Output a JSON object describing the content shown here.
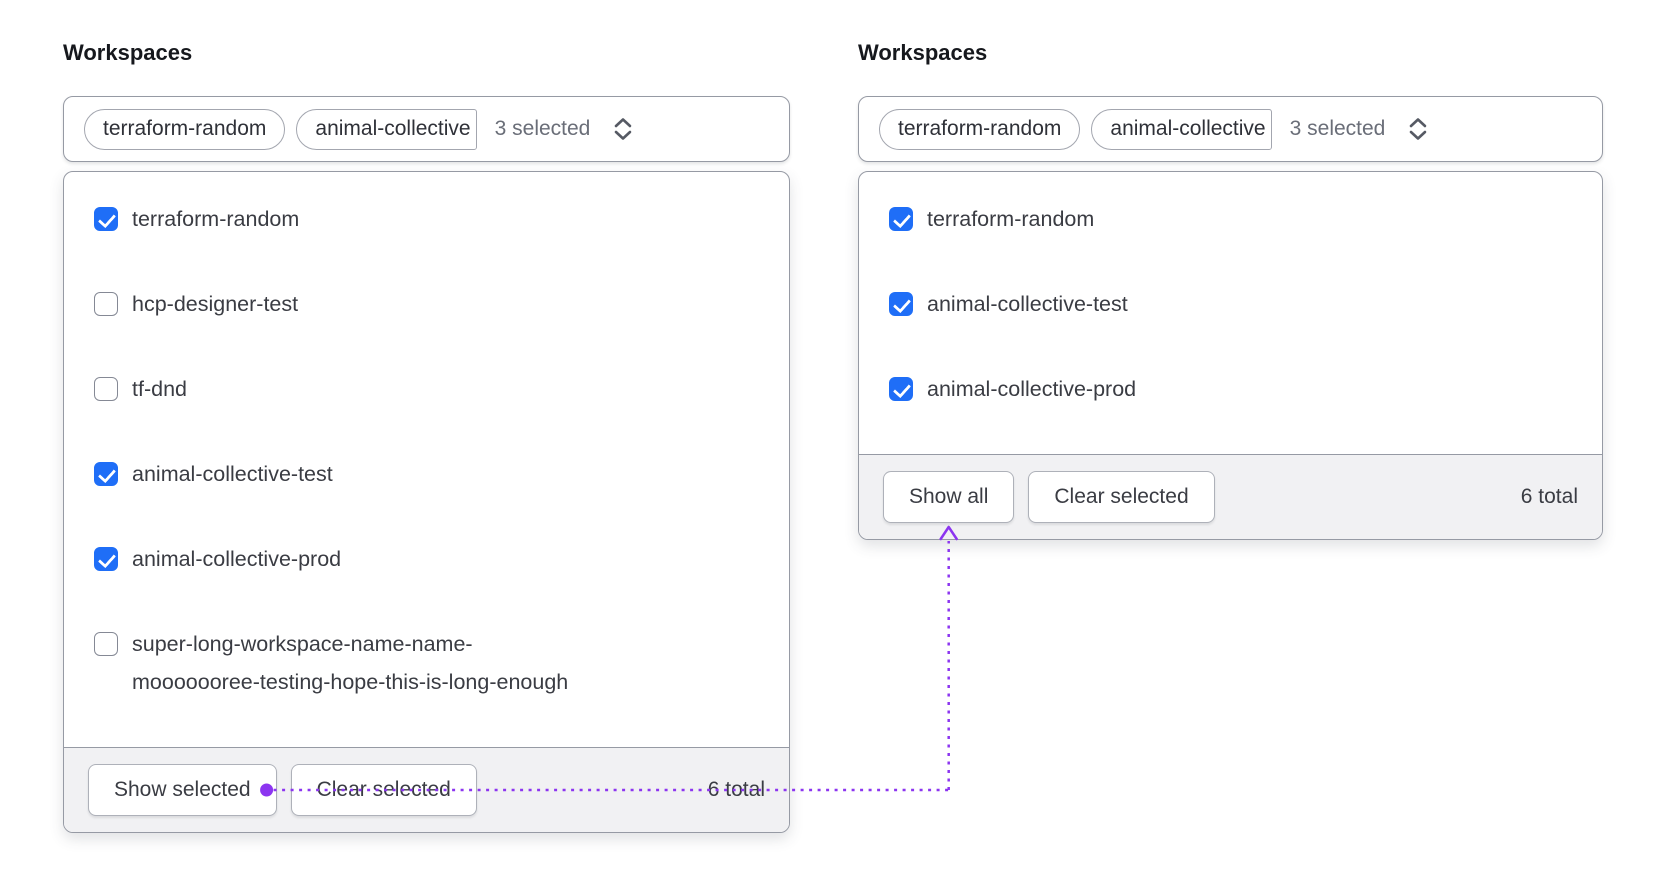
{
  "colors": {
    "checkbox_blue": "#1f6ef7",
    "annotation_purple": "#8c35f0",
    "panel_border": "#969aa4",
    "footer_bg": "#f1f1f3"
  },
  "panels": [
    {
      "label": "Workspaces",
      "trigger": {
        "tags": [
          "terraform-random",
          "animal-collective"
        ],
        "summary": "3 selected",
        "chevron_icon": "chevron-up-down"
      },
      "items": [
        {
          "label": "terraform-random",
          "checked": true
        },
        {
          "label": "hcp-designer-test",
          "checked": false
        },
        {
          "label": "tf-dnd",
          "checked": false
        },
        {
          "label": "animal-collective-test",
          "checked": true
        },
        {
          "label": "animal-collective-prod",
          "checked": true
        },
        {
          "label": "super-long-workspace-name-name-mooooooree-testing-hope-this-is-long-enough",
          "checked": false
        }
      ],
      "footer": {
        "show_button": "Show selected",
        "clear_button": "Clear selected",
        "total": "6 total"
      }
    },
    {
      "label": "Workspaces",
      "trigger": {
        "tags": [
          "terraform-random",
          "animal-collective"
        ],
        "summary": "3 selected",
        "chevron_icon": "chevron-up-down"
      },
      "items": [
        {
          "label": "terraform-random",
          "checked": true
        },
        {
          "label": "animal-collective-test",
          "checked": true
        },
        {
          "label": "animal-collective-prod",
          "checked": true
        }
      ],
      "footer": {
        "show_button": "Show all",
        "clear_button": "Clear selected",
        "total": "6 total"
      }
    }
  ]
}
